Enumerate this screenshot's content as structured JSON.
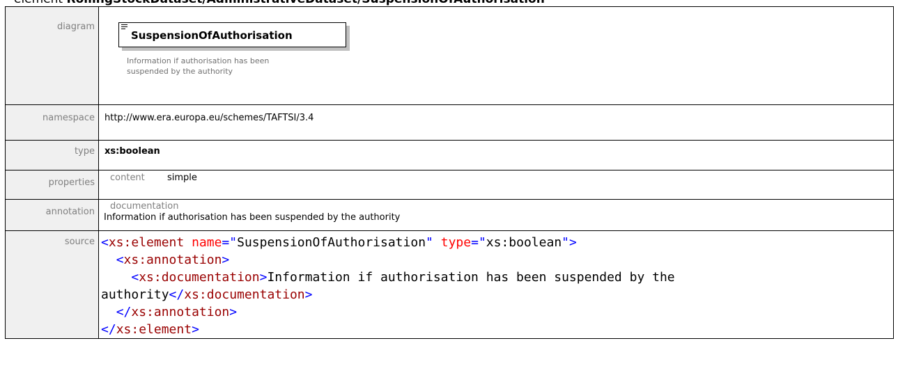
{
  "header": {
    "lead": "element ",
    "path": "RollingStockDataset/AdministrativeDataset/SuspensionOfAuthorisation"
  },
  "labels": {
    "diagram": "diagram",
    "namespace": "namespace",
    "type": "type",
    "properties": "properties",
    "annotation": "annotation",
    "source": "source"
  },
  "diagram": {
    "element_name": "SuspensionOfAuthorisation",
    "doc_line1": "Information if authorisation has been",
    "doc_line2": "suspended by the authority",
    "icon": "element-glyph-icon"
  },
  "namespace": "http://www.era.europa.eu/schemes/TAFTSI/3.4",
  "type": "xs:boolean",
  "properties": {
    "key": "content",
    "value": "simple"
  },
  "annotation": {
    "key": "documentation",
    "text": "Information if authorisation has been suspended by the authority"
  },
  "source": {
    "open_lt": "<",
    "tag_element": "xs:element",
    "attr_name": "name",
    "eq": "=",
    "q": "\"",
    "name_value": "SuspensionOfAuthorisation",
    "attr_type": "type",
    "type_value": "xs:boolean",
    "gt": ">",
    "tag_annotation": "xs:annotation",
    "tag_documentation": "xs:documentation",
    "doc_text": "Information if authorisation has been suspended by the authority",
    "close_lt": "</"
  },
  "colors": {
    "label_bg": "#f0f0f0",
    "label_text": "#808080",
    "xml_punct": "#0000ff",
    "xml_tag": "#990000",
    "xml_attr": "#ff0000"
  }
}
